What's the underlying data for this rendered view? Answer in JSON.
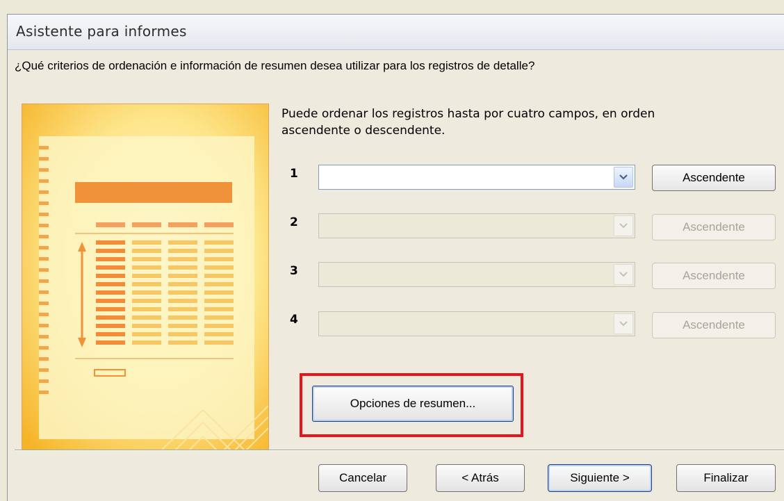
{
  "window": {
    "title": "Asistente para informes"
  },
  "question": "¿Qué criterios de ordenación e información de resumen desea utilizar para los registros de detalle?",
  "instructions": "Puede ordenar los registros hasta por cuatro campos, en orden ascendente o descendente.",
  "sort_fields": [
    {
      "number": "1",
      "value": "",
      "order": "Ascendente",
      "enabled": true
    },
    {
      "number": "2",
      "value": "",
      "order": "Ascendente",
      "enabled": false
    },
    {
      "number": "3",
      "value": "",
      "order": "Ascendente",
      "enabled": false
    },
    {
      "number": "4",
      "value": "",
      "order": "Ascendente",
      "enabled": false
    }
  ],
  "summary_button": {
    "label": "Opciones de resumen...",
    "mnemonic": "O",
    "highlight_color": "#e8141b"
  },
  "footer": {
    "cancel": "Cancelar",
    "back": "< Atrás",
    "next": "Siguiente >",
    "finish": "Finalizar"
  },
  "icons": {
    "dropdown": "chevron-down-icon",
    "illustration": "report-wizard-illustration"
  }
}
